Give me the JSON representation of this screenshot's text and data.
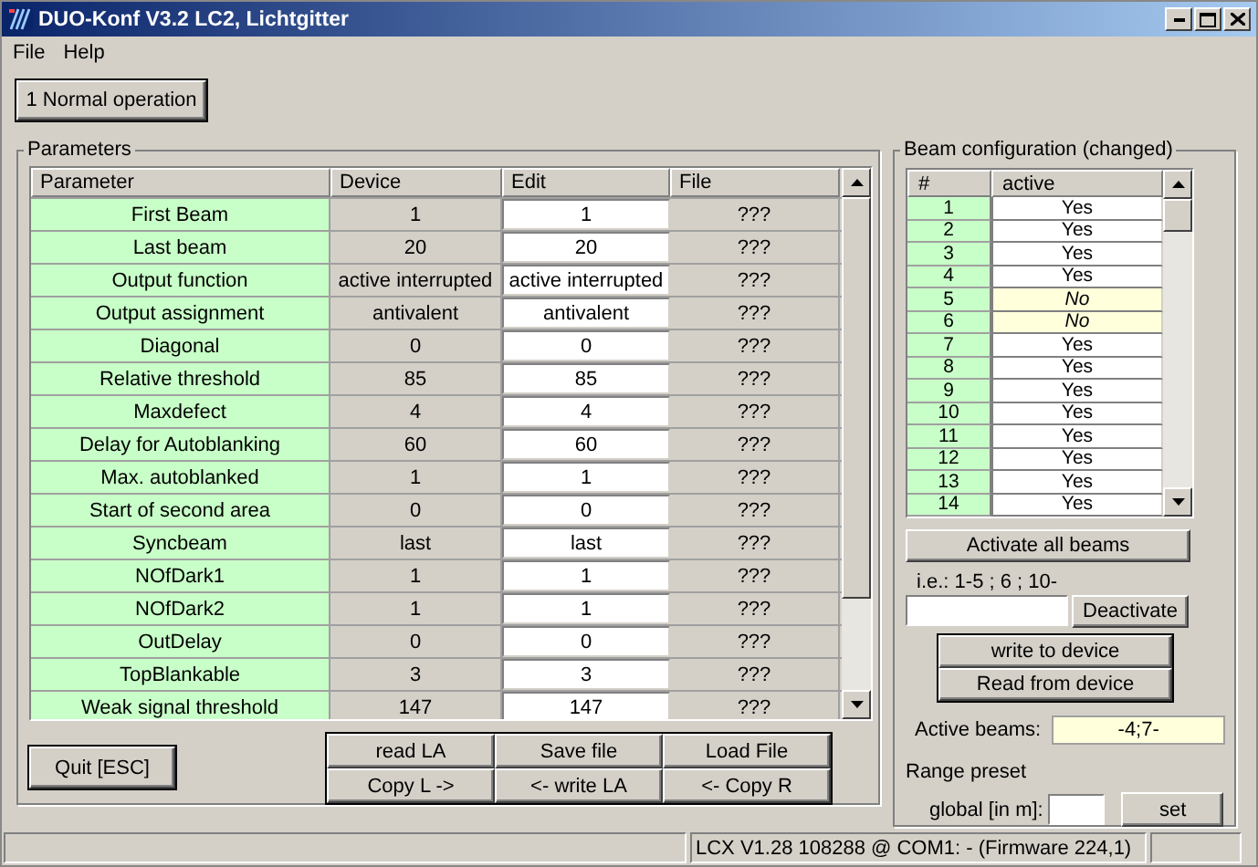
{
  "window": {
    "title": "DUO-Konf V3.2 LC2, Lichtgitter"
  },
  "menu": [
    "File",
    "Help"
  ],
  "mode_button": "1 Normal operation",
  "parameters": {
    "title": "Parameters",
    "columns": [
      "Parameter",
      "Device",
      "Edit",
      "File"
    ],
    "rows": [
      {
        "parameter": "First Beam",
        "device": "1",
        "edit": "1",
        "file": "???"
      },
      {
        "parameter": "Last beam",
        "device": "20",
        "edit": "20",
        "file": "???"
      },
      {
        "parameter": "Output function",
        "device": "active interrupted",
        "edit": "active interrupted",
        "file": "???"
      },
      {
        "parameter": "Output assignment",
        "device": "antivalent",
        "edit": "antivalent",
        "file": "???"
      },
      {
        "parameter": "Diagonal",
        "device": "0",
        "edit": "0",
        "file": "???"
      },
      {
        "parameter": "Relative threshold",
        "device": "85",
        "edit": "85",
        "file": "???"
      },
      {
        "parameter": "Maxdefect",
        "device": "4",
        "edit": "4",
        "file": "???"
      },
      {
        "parameter": "Delay for Autoblanking",
        "device": "60",
        "edit": "60",
        "file": "???"
      },
      {
        "parameter": "Max. autoblanked",
        "device": "1",
        "edit": "1",
        "file": "???"
      },
      {
        "parameter": "Start of second area",
        "device": "0",
        "edit": "0",
        "file": "???"
      },
      {
        "parameter": "Syncbeam",
        "device": "last",
        "edit": "last",
        "file": "???"
      },
      {
        "parameter": "NOfDark1",
        "device": "1",
        "edit": "1",
        "file": "???"
      },
      {
        "parameter": "NOfDark2",
        "device": "1",
        "edit": "1",
        "file": "???"
      },
      {
        "parameter": "OutDelay",
        "device": "0",
        "edit": "0",
        "file": "???"
      },
      {
        "parameter": "TopBlankable",
        "device": "3",
        "edit": "3",
        "file": "???"
      },
      {
        "parameter": "Weak signal threshold",
        "device": "147",
        "edit": "147",
        "file": "???"
      }
    ]
  },
  "quit_button": "Quit [ESC]",
  "action_buttons": [
    [
      "read LA",
      "Save file",
      "Load File"
    ],
    [
      "Copy L ->",
      "<- write LA",
      "<- Copy R"
    ]
  ],
  "beams": {
    "title": "Beam configuration (changed)",
    "columns": [
      "#",
      "active"
    ],
    "rows": [
      {
        "number": "1",
        "active": "Yes",
        "changed": false
      },
      {
        "number": "2",
        "active": "Yes",
        "changed": false
      },
      {
        "number": "3",
        "active": "Yes",
        "changed": false
      },
      {
        "number": "4",
        "active": "Yes",
        "changed": false
      },
      {
        "number": "5",
        "active": "No",
        "changed": true
      },
      {
        "number": "6",
        "active": "No",
        "changed": true
      },
      {
        "number": "7",
        "active": "Yes",
        "changed": false
      },
      {
        "number": "8",
        "active": "Yes",
        "changed": false
      },
      {
        "number": "9",
        "active": "Yes",
        "changed": false
      },
      {
        "number": "10",
        "active": "Yes",
        "changed": false
      },
      {
        "number": "11",
        "active": "Yes",
        "changed": false
      },
      {
        "number": "12",
        "active": "Yes",
        "changed": false
      },
      {
        "number": "13",
        "active": "Yes",
        "changed": false
      },
      {
        "number": "14",
        "active": "Yes",
        "changed": false
      }
    ],
    "activate_all": "Activate all beams",
    "range_hint": "i.e.: 1-5 ; 6 ; 10-",
    "deactivate": "Deactivate",
    "write_button": "write to device",
    "read_button": "Read from device",
    "active_label": "Active beams:",
    "active_value": "-4;7-",
    "range_title": "Range preset",
    "global_label": "global [in m]:",
    "set_button": "set"
  },
  "status_bar": "LCX V1.28 108288 @ COM1: - (Firmware 224,1)"
}
